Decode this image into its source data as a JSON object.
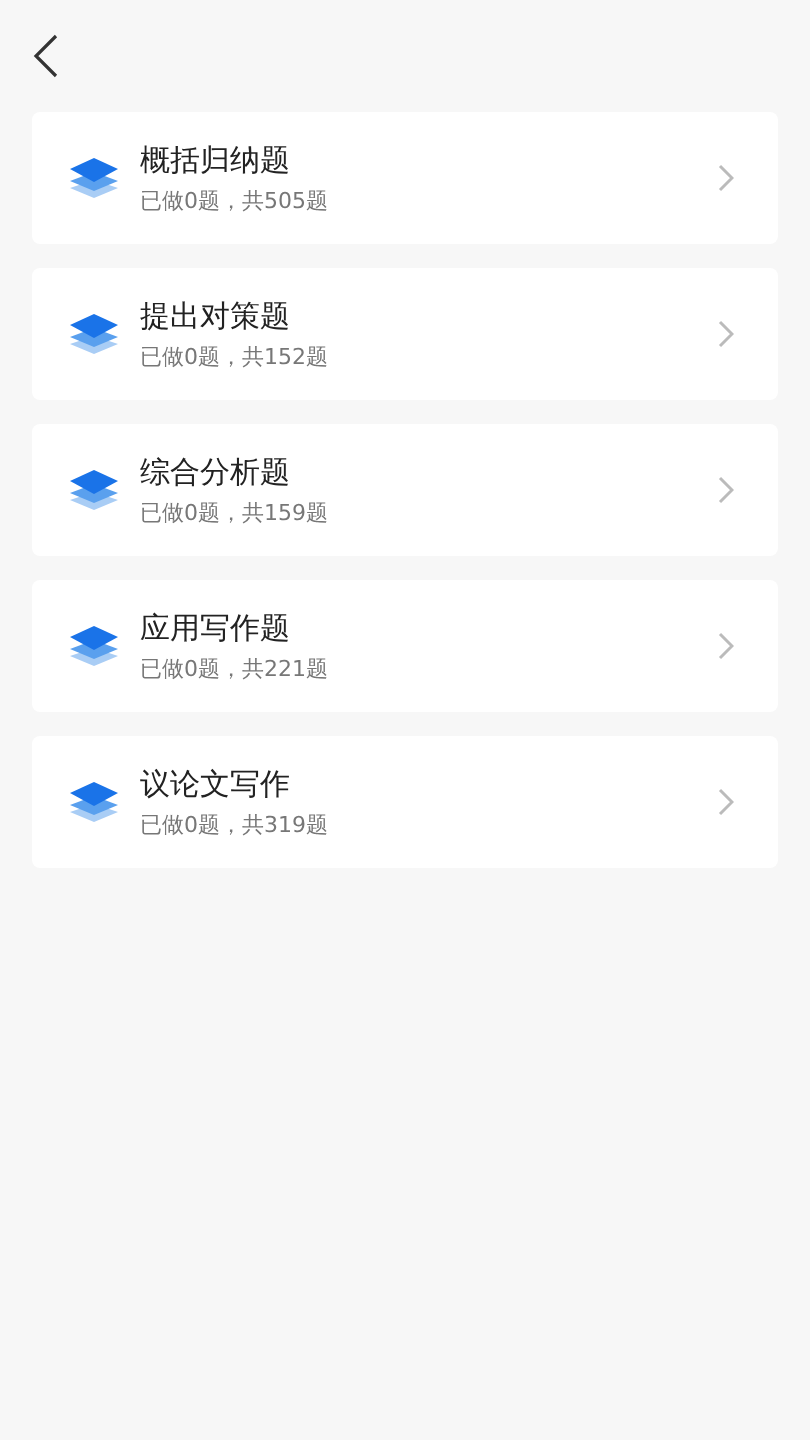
{
  "categories": [
    {
      "title": "概括归纳题",
      "progress": "已做0题，共505题"
    },
    {
      "title": "提出对策题",
      "progress": "已做0题，共152题"
    },
    {
      "title": "综合分析题",
      "progress": "已做0题，共159题"
    },
    {
      "title": "应用写作题",
      "progress": "已做0题，共221题"
    },
    {
      "title": "议论文写作",
      "progress": "已做0题，共319题"
    }
  ]
}
